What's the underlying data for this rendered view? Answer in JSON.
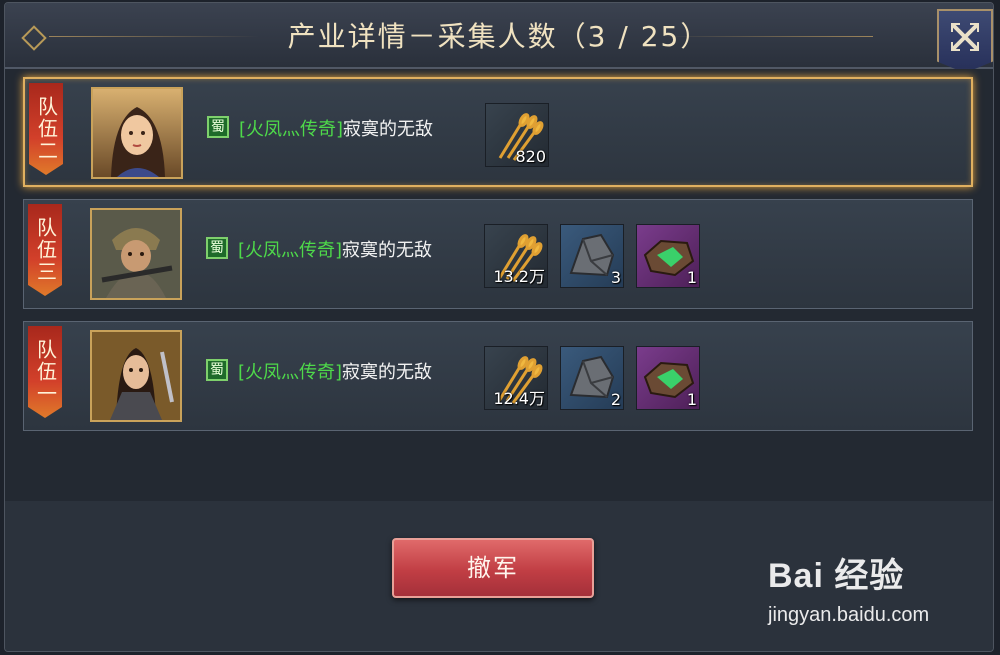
{
  "window": {
    "title": "产业详情－采集人数（3 / 25）"
  },
  "close_icon": "close-x-icon",
  "colors": {
    "accent_gold": "#e0b060",
    "clan_green": "#4ed94a",
    "button_red": "#c13e44"
  },
  "rows": [
    {
      "team_label": "队伍二",
      "selected": true,
      "portrait_icon": "general-portrait-female",
      "faction": "蜀",
      "clan": "[火凤灬传奇]",
      "player": "寂寞的无敌",
      "items": [
        {
          "type": "grain",
          "icon": "wheat-icon",
          "count": "820"
        }
      ]
    },
    {
      "team_label": "队伍三",
      "selected": false,
      "portrait_icon": "general-portrait-warrior",
      "faction": "蜀",
      "clan": "[火凤灬传奇]",
      "player": "寂寞的无敌",
      "items": [
        {
          "type": "grain",
          "icon": "wheat-icon",
          "count": "13.2万"
        },
        {
          "type": "stone",
          "icon": "stone-ore-icon",
          "count": "3"
        },
        {
          "type": "gem",
          "icon": "jade-ore-icon",
          "count": "1"
        }
      ]
    },
    {
      "team_label": "队伍一",
      "selected": false,
      "portrait_icon": "general-portrait-armored",
      "faction": "蜀",
      "clan": "[火凤灬传奇]",
      "player": "寂寞的无敌",
      "items": [
        {
          "type": "grain",
          "icon": "wheat-icon",
          "count": "12.4万"
        },
        {
          "type": "stone",
          "icon": "stone-ore-icon",
          "count": "2"
        },
        {
          "type": "gem",
          "icon": "jade-ore-icon",
          "count": "1"
        }
      ]
    }
  ],
  "withdraw_button": {
    "label": "撤军"
  },
  "watermark": {
    "brand": "Bai 经验",
    "url": "jingyan.baidu.com"
  }
}
